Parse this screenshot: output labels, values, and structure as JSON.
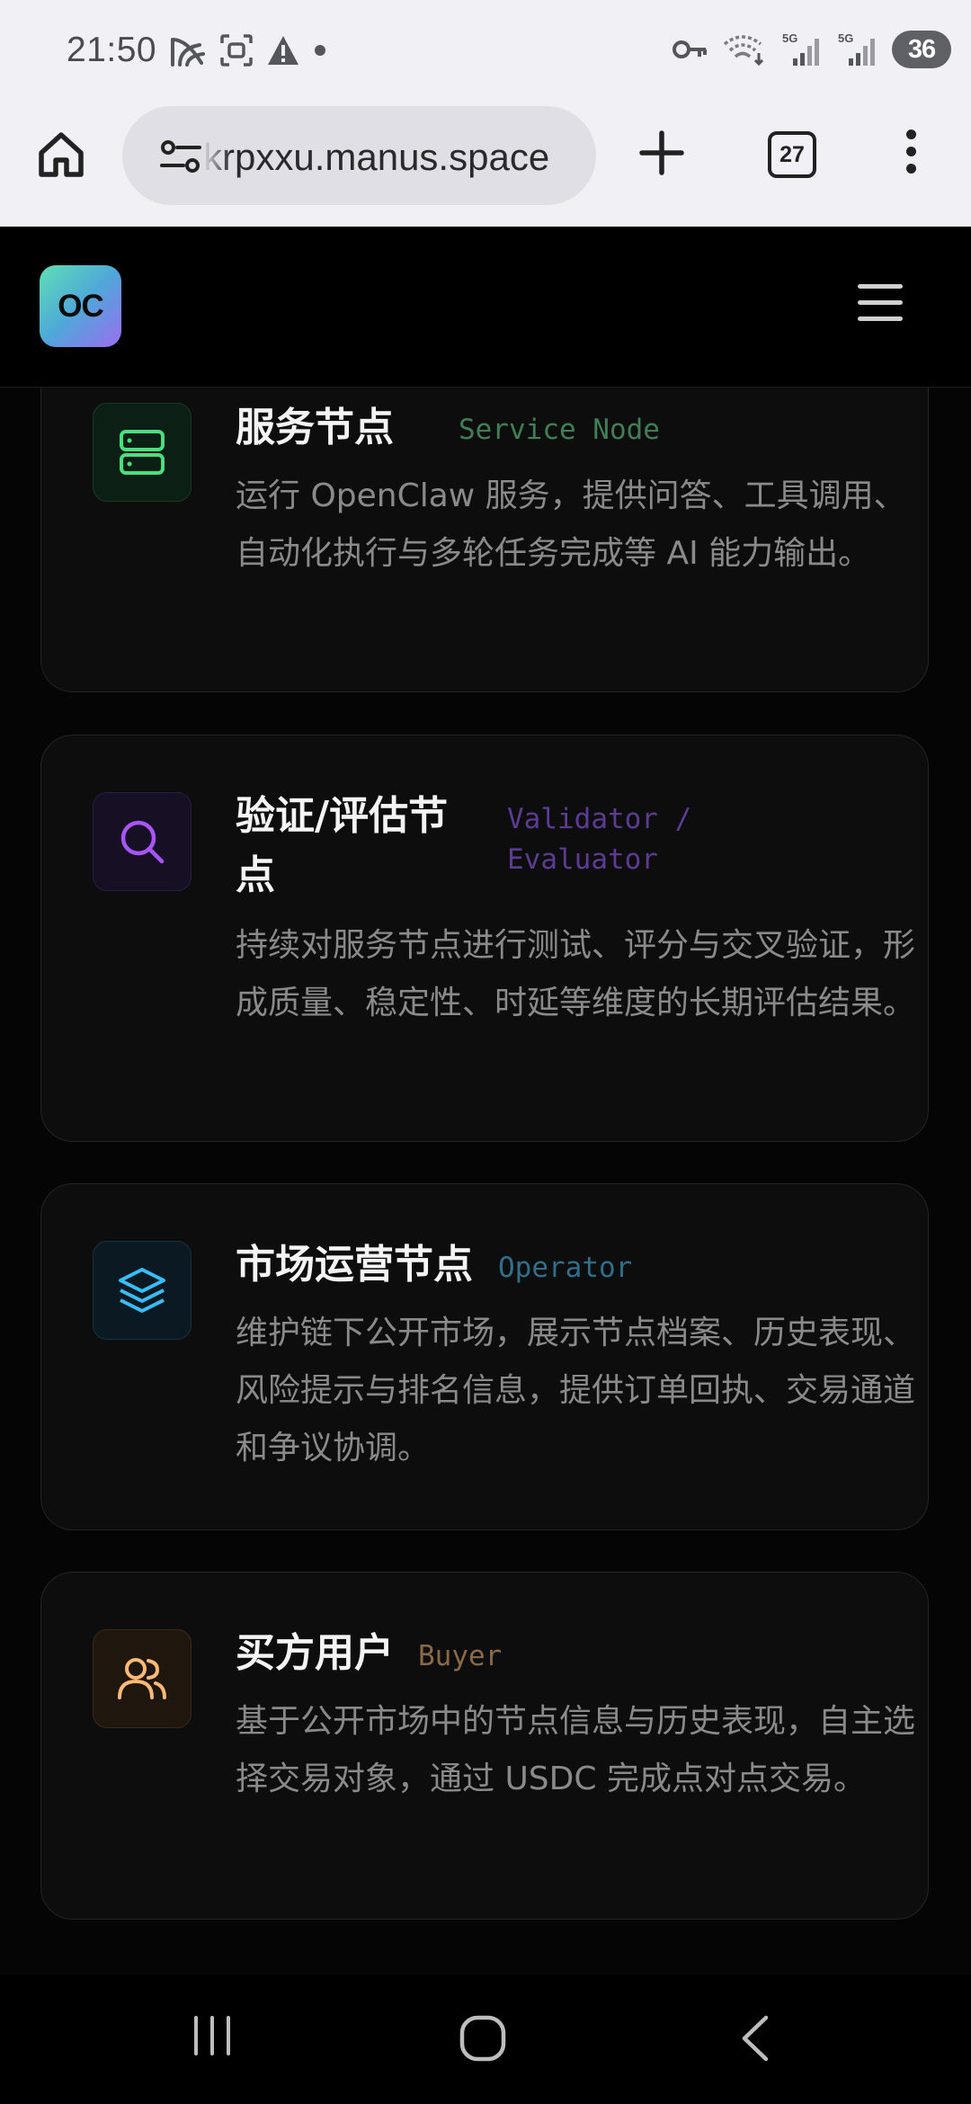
{
  "status_bar": {
    "time": "21:50",
    "battery": "36"
  },
  "browser": {
    "url": "krpxxu.manus.space",
    "tab_count": "27"
  },
  "site": {
    "logo_text": "OC"
  },
  "cards": [
    {
      "title": "服务节点",
      "tag": "Service Node",
      "description": "运行 OpenClaw 服务，提供问答、工具调用、自动化执行与多轮任务完成等 AI 能力输出。",
      "icon": "server-icon",
      "accent": "#4ade80"
    },
    {
      "title_lines": [
        "验证/评估节",
        "点"
      ],
      "tag_lines": [
        "Validator /",
        "Evaluator"
      ],
      "description": "持续对服务节点进行测试、评分与交叉验证，形成质量、稳定性、时延等维度的长期评估结果。",
      "icon": "search-icon",
      "accent": "#a855f7"
    },
    {
      "title": "市场运营节点",
      "tag": "Operator",
      "description": "维护链下公开市场，展示节点档案、历史表现、风险提示与排名信息，提供订单回执、交易通道和争议协调。",
      "icon": "layers-icon",
      "accent": "#38bdf8"
    },
    {
      "title": "买方用户",
      "tag": "Buyer",
      "description": "基于公开市场中的节点信息与历史表现，自主选择交易对象，通过 USDC 完成点对点交易。",
      "icon": "users-icon",
      "accent": "#fdba74"
    }
  ]
}
